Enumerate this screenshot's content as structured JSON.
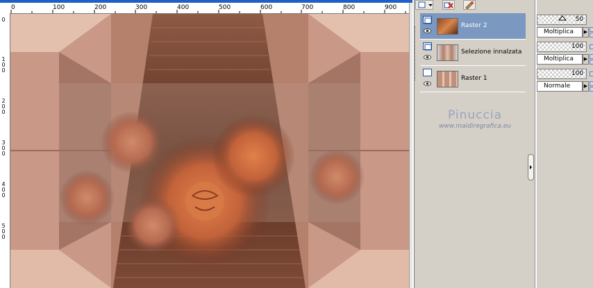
{
  "ruler": {
    "h_labels": [
      "0",
      "100",
      "200",
      "300",
      "400",
      "500",
      "600",
      "700",
      "800",
      "900"
    ],
    "v_labels": [
      "0",
      "1 0 0",
      "2 0 0",
      "3 0 0",
      "4 0 0",
      "5 0 0"
    ]
  },
  "toolbar": {
    "icons": [
      "new-layer-icon",
      "delete-layer-icon",
      "layer-properties-icon"
    ]
  },
  "layers": [
    {
      "name": "Raster 2",
      "selected": true,
      "thumb": "roses-thumbnail-icon"
    },
    {
      "name": "Selezione innalzata",
      "selected": false,
      "thumb": "promoted-selection-thumbnail-icon"
    },
    {
      "name": "Raster 1",
      "selected": false,
      "thumb": "raster-thumbnail-icon"
    }
  ],
  "properties": [
    {
      "opacity": "50",
      "blend_mode": "Moltiplica"
    },
    {
      "opacity": "100",
      "blend_mode": "Moltiplica"
    },
    {
      "opacity": "100",
      "blend_mode": "Normale"
    }
  ],
  "watermark": {
    "name": "Pinuccia",
    "url": "www.maidiregrafica.eu"
  },
  "colors": {
    "selected_row": "#7b98c1",
    "ruler_bar": "#1f5fc8",
    "panel_bg": "#d4d0c8"
  }
}
